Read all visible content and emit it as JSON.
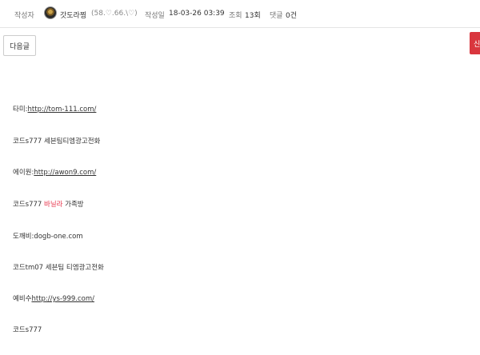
{
  "meta": {
    "author_label": "작성자",
    "author_name": "갓도라찡",
    "author_stats": "(58.♡.66.\\♡)",
    "date_label": "작성일",
    "date_value": "18-03-26 03:39",
    "views_label": "조회",
    "views_value": "13회",
    "comments_label": "댓글",
    "comments_value": "0건"
  },
  "nav": {
    "next_label": "다음글",
    "right_button_label": "신"
  },
  "post": {
    "line1_prefix": "타미:",
    "line1_link": "http://tom-111.com/",
    "line2": "코드s777  세븐팀티엠광고전화",
    "line3_prefix": "에이원:",
    "line3_link": "http://awon9.com/",
    "line4_prefix": "코드s777  ",
    "line4_highlight": "바닐라",
    "line4_suffix": " 가족방",
    "line5": "도깨비:dogb-one.com",
    "line6": "코드tm07 세븐팀 티엠광고전화",
    "line7_prefix": "예비수",
    "line7_link": "http://ys-999.com/",
    "line8": "코드s777"
  },
  "colors": {
    "accent_red": "#d9363e",
    "highlight_pink": "#e8384f"
  }
}
